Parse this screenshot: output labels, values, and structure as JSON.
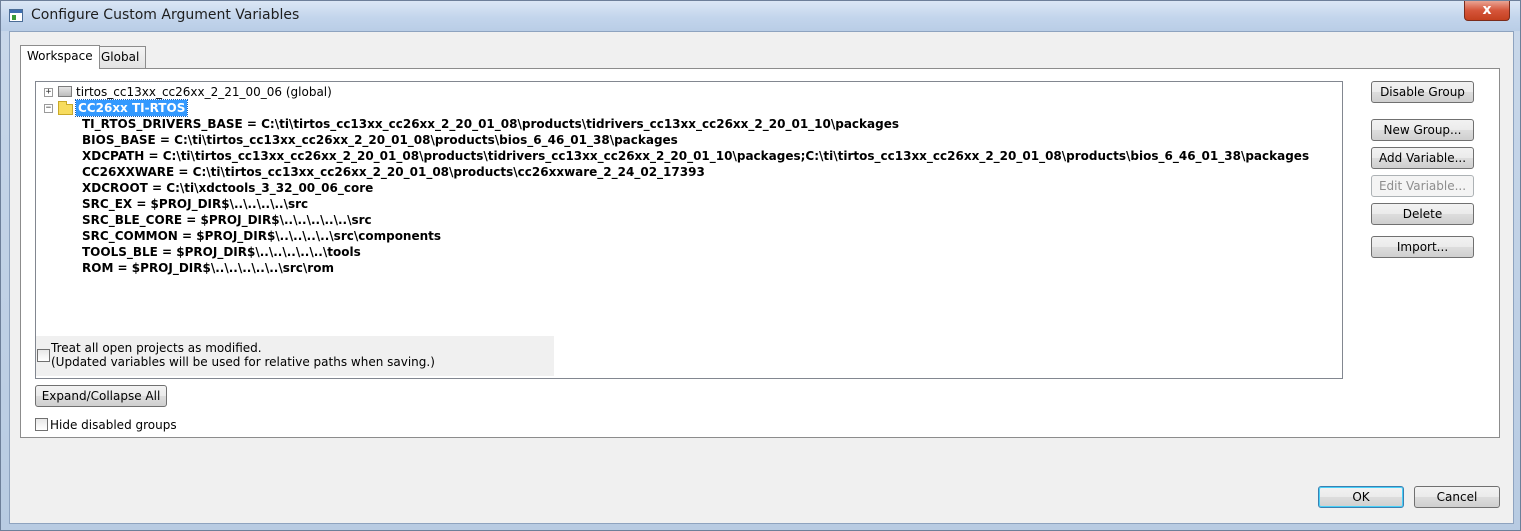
{
  "window": {
    "title": "Configure Custom Argument Variables",
    "close_symbol": "x"
  },
  "tabs": [
    {
      "label": "Workspace",
      "active": true
    },
    {
      "label": "Global",
      "active": false
    }
  ],
  "tree": {
    "groups": [
      {
        "label": "tirtos_cc13xx_cc26xx_2_21_00_06 (global)",
        "expander": "+",
        "icon": "group-icon"
      },
      {
        "label": "CC26xx TI-RTOS",
        "expander": "−",
        "icon": "folder-icon",
        "selected": true
      }
    ],
    "variables": [
      "TI_RTOS_DRIVERS_BASE  =  C:\\ti\\tirtos_cc13xx_cc26xx_2_20_01_08\\products\\tidrivers_cc13xx_cc26xx_2_20_01_10\\packages",
      "BIOS_BASE  =  C:\\ti\\tirtos_cc13xx_cc26xx_2_20_01_08\\products\\bios_6_46_01_38\\packages",
      "XDCPATH  =  C:\\ti\\tirtos_cc13xx_cc26xx_2_20_01_08\\products\\tidrivers_cc13xx_cc26xx_2_20_01_10\\packages;C:\\ti\\tirtos_cc13xx_cc26xx_2_20_01_08\\products\\bios_6_46_01_38\\packages",
      "CC26XXWARE  =  C:\\ti\\tirtos_cc13xx_cc26xx_2_20_01_08\\products\\cc26xxware_2_24_02_17393",
      "XDCROOT  =  C:\\ti\\xdctools_3_32_00_06_core",
      "SRC_EX  =  $PROJ_DIR$\\..\\..\\..\\..\\src",
      "SRC_BLE_CORE  =  $PROJ_DIR$\\..\\..\\..\\..\\..\\src",
      "SRC_COMMON  =  $PROJ_DIR$\\..\\..\\..\\..\\src\\components",
      "TOOLS_BLE  =  $PROJ_DIR$\\..\\..\\..\\..\\..\\tools",
      "ROM  =  $PROJ_DIR$\\..\\..\\..\\..\\..\\src\\rom"
    ]
  },
  "treat_modified": {
    "line1": "Treat all open projects as modified.",
    "line2": "(Updated variables will be used for relative paths when saving.)",
    "checked": false
  },
  "buttons": {
    "disable_group": "Disable Group",
    "new_group": "New Group...",
    "add_variable": "Add Variable...",
    "edit_variable": "Edit Variable...",
    "delete": "Delete",
    "import": "Import...",
    "expand_collapse": "Expand/Collapse All",
    "ok": "OK",
    "cancel": "Cancel"
  },
  "hide_disabled": {
    "label": "Hide disabled groups",
    "checked": false
  }
}
